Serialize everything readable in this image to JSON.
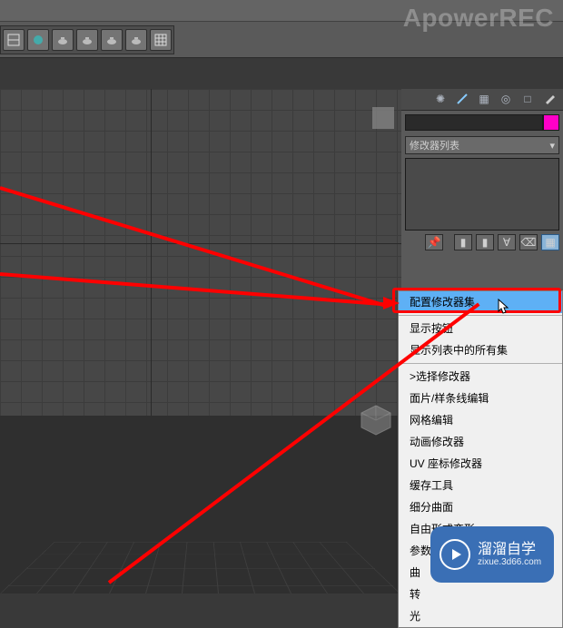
{
  "watermark": "ApowerREC",
  "toolbar": {
    "buttons": [
      "align",
      "sphere",
      "teapot1",
      "teapot2",
      "teapot3",
      "teapot4",
      "grid"
    ]
  },
  "cmd_panel": {
    "tabs": [
      "create",
      "modify",
      "hierarchy",
      "motion",
      "display",
      "utilities"
    ],
    "modifier_list_label": "修改器列表"
  },
  "context_menu": {
    "items": [
      {
        "label": "配置修改器集",
        "highlighted": true
      },
      {
        "sep": true
      },
      {
        "label": "显示按钮"
      },
      {
        "label": "显示列表中的所有集"
      },
      {
        "sep": true
      },
      {
        "label": ">选择修改器"
      },
      {
        "label": "面片/样条线编辑"
      },
      {
        "label": "网格编辑"
      },
      {
        "label": "动画修改器"
      },
      {
        "label": "UV 座标修改器"
      },
      {
        "label": "缓存工具"
      },
      {
        "label": "细分曲面"
      },
      {
        "label": "自由形式变形"
      },
      {
        "label": "参数化修改器"
      },
      {
        "label": "曲"
      },
      {
        "label": "转"
      },
      {
        "label": "光"
      }
    ]
  },
  "badge": {
    "title": "溜溜自学",
    "sub": "zixue.3d66.com"
  }
}
